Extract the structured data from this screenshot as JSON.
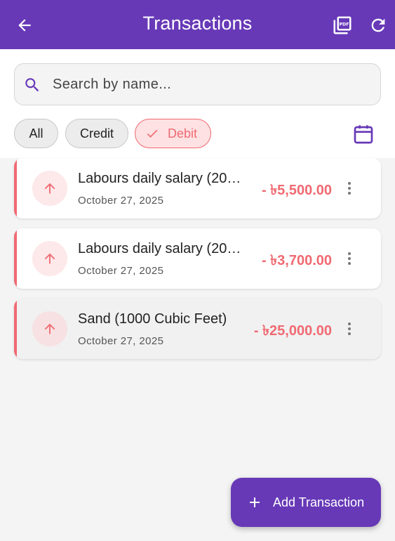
{
  "appbar": {
    "title": "Transactions",
    "back_icon": "arrow-left-icon",
    "pdf_icon": "pdf-export-icon",
    "refresh_icon": "refresh-icon",
    "color": "#6739b7"
  },
  "search": {
    "placeholder": "Search by name...",
    "value": ""
  },
  "filters": {
    "all": "All",
    "credit": "Credit",
    "debit": "Debit",
    "selected": "Debit"
  },
  "transactions": [
    {
      "name": "Labours daily salary (20…",
      "date": "October 27, 2025",
      "amount": "- ৳5,500.00"
    },
    {
      "name": "Labours daily salary (20…",
      "date": "October 27, 2025",
      "amount": "- ৳3,700.00"
    },
    {
      "name": "Sand (1000 Cubic Feet)",
      "date": "October 27, 2025",
      "amount": "- ৳25,000.00"
    }
  ],
  "fab": {
    "label": "Add Transaction"
  },
  "colors": {
    "accent": "#6739b7",
    "debit": "#f06a72"
  }
}
